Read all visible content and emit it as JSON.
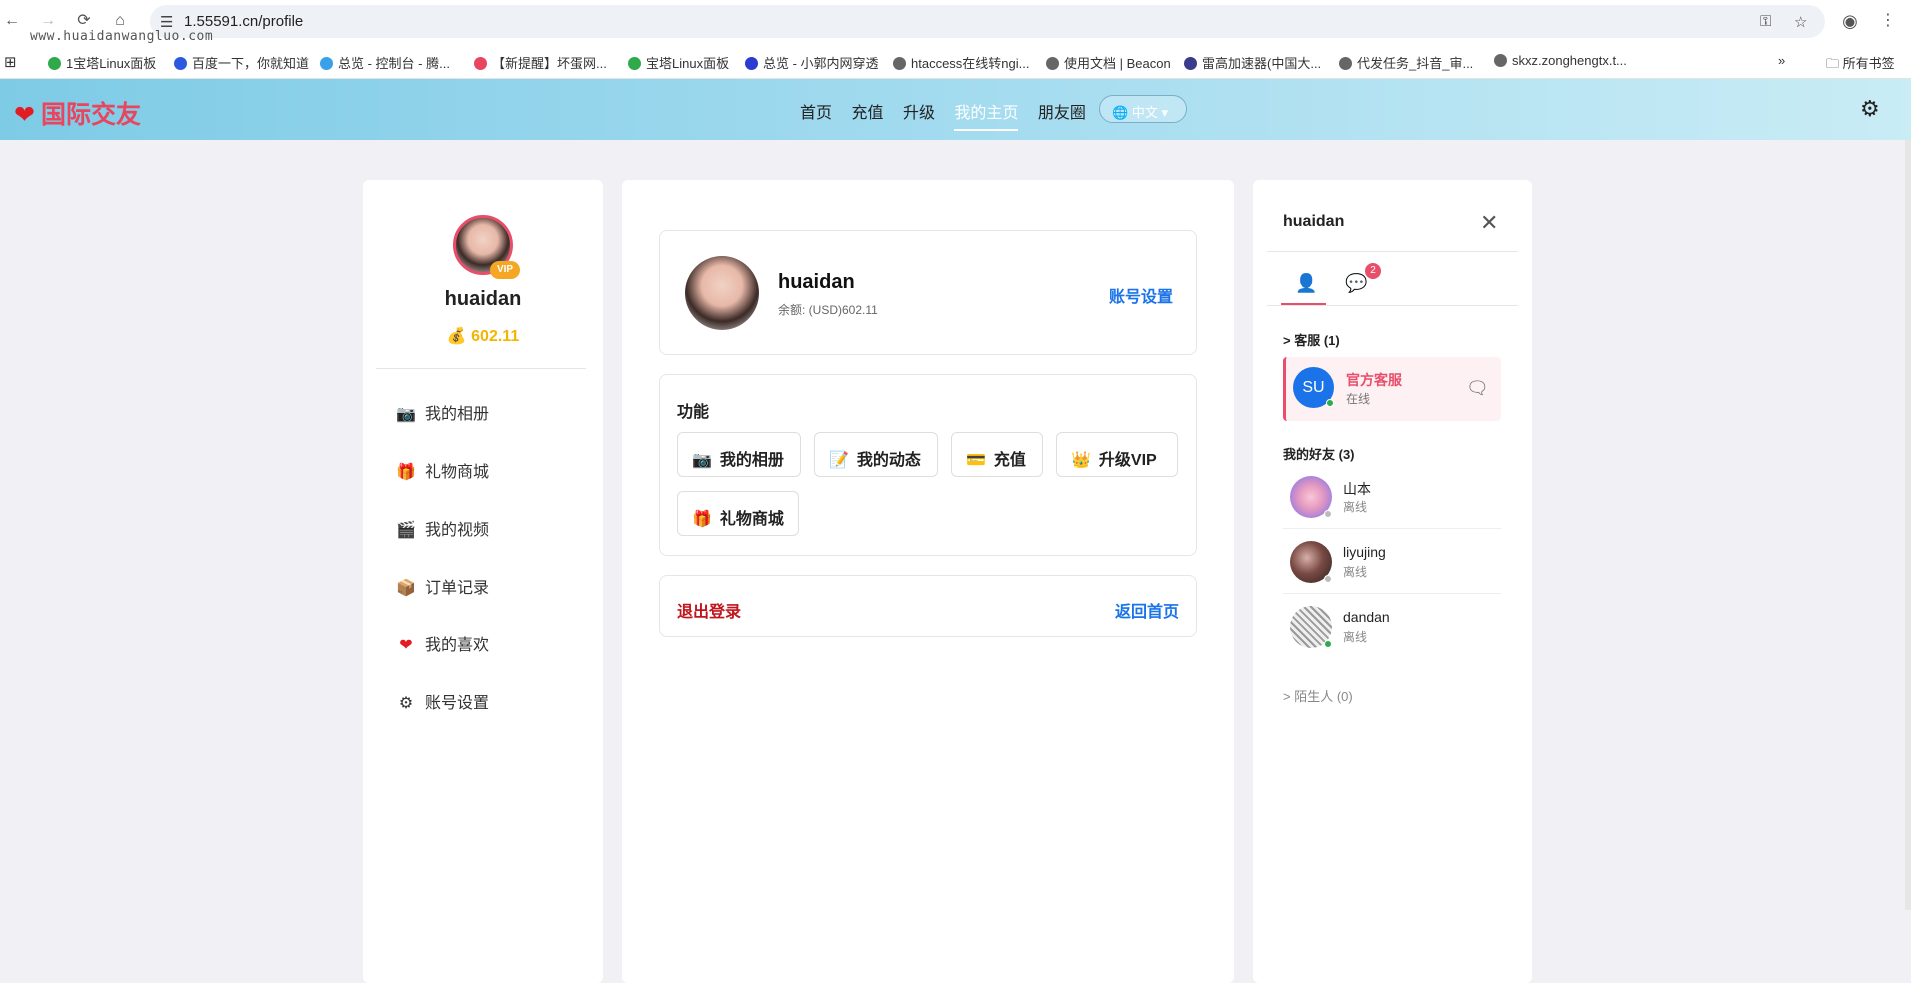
{
  "browser": {
    "url": "1.55591.cn/profile",
    "bookmarks": [
      "1宝塔Linux面板",
      "百度一下，你就知道",
      "总览 - 控制台 - 腾...",
      "【新提醒】坏蛋网...",
      "宝塔Linux面板",
      "总览 - 小郭内网穿透",
      "htaccess在线转ngi...",
      "使用文档 | Beacon",
      "雷高加速器(中国大...",
      "代发任务_抖音_审...",
      "skxz.zonghengtx.t..."
    ],
    "all_bookmarks": "所有书签",
    "watermark": "www.huaidanwangluo.com"
  },
  "header": {
    "logo": "国际交友",
    "nav": [
      "首页",
      "充值",
      "升级",
      "我的主页",
      "朋友圈"
    ],
    "active_nav": "我的主页",
    "lang": "中文"
  },
  "left": {
    "username": "huaidan",
    "vip": "VIP",
    "coins": "602.11",
    "menu": [
      {
        "icon": "camera-icon",
        "label": "我的相册"
      },
      {
        "icon": "gift-icon",
        "label": "礼物商城"
      },
      {
        "icon": "clapper-icon",
        "label": "我的视频"
      },
      {
        "icon": "box-icon",
        "label": "订单记录"
      },
      {
        "icon": "heart-icon",
        "label": "我的喜欢"
      },
      {
        "icon": "gear-icon",
        "label": "账号设置"
      }
    ]
  },
  "center": {
    "username": "huaidan",
    "balance": "余额: (USD)602.11",
    "account_settings": "账号设置",
    "features_title": "功能",
    "features": [
      {
        "icon": "camera-icon",
        "label": "我的相册"
      },
      {
        "icon": "memo-icon",
        "label": "我的动态"
      },
      {
        "icon": "card-icon",
        "label": "充值"
      },
      {
        "icon": "crown-icon",
        "label": "升级VIP"
      },
      {
        "icon": "gift-icon",
        "label": "礼物商城"
      }
    ],
    "logout": "退出登录",
    "back_home": "返回首页"
  },
  "chat": {
    "username": "huaidan",
    "unread_count": "2",
    "service_section": "> 客服 (1)",
    "service": {
      "avatar_text": "SU",
      "name": "官方客服",
      "status": "在线"
    },
    "friends_section": "我的好友 (3)",
    "friends": [
      {
        "name": "山本",
        "status": "离线"
      },
      {
        "name": "liyujing",
        "status": "离线"
      },
      {
        "name": "dandan",
        "status": "离线"
      }
    ],
    "strangers_section": "> 陌生人 (0)"
  },
  "colors": {
    "brand": "#e8455f",
    "link": "#1a73e8",
    "gold": "#f5b400",
    "danger": "#c0151c"
  }
}
